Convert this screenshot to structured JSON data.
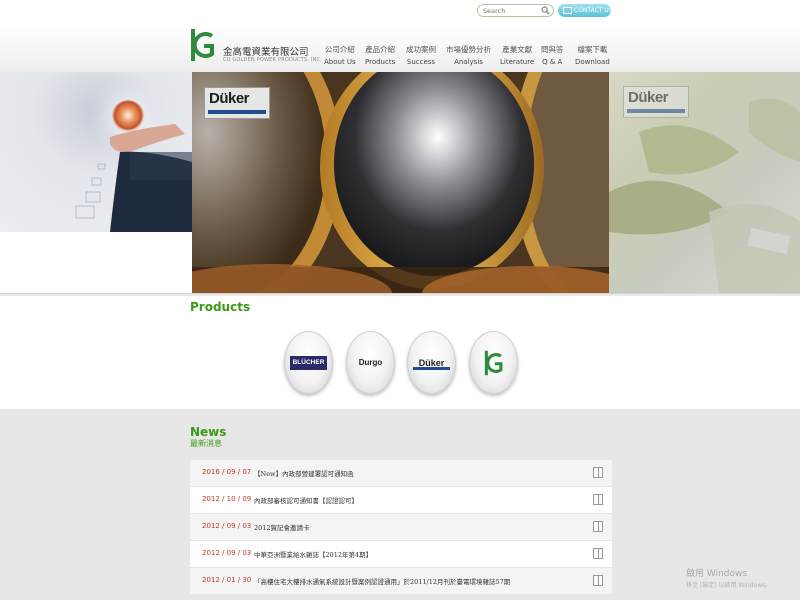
{
  "header": {
    "search_placeholder": "Search",
    "contact_label": "CONTACT US",
    "brand_cn": "金高電資業有限公司",
    "brand_en": "CU GOLDEN POWER PRODUCTS, INC.",
    "nav": [
      {
        "cn": "公司介紹",
        "en": "About Us"
      },
      {
        "cn": "產品介紹",
        "en": "Products"
      },
      {
        "cn": "成功案例",
        "en": "Success"
      },
      {
        "cn": "市場優勢分析",
        "en": "Analysis"
      },
      {
        "cn": "產業文獻",
        "en": "Literature"
      },
      {
        "cn": "問與答",
        "en": "Q & A"
      },
      {
        "cn": "檔案下載",
        "en": "Download"
      }
    ]
  },
  "hero": {
    "brand_badge": "Düker",
    "side_badge": "Düker"
  },
  "products": {
    "title": "Products",
    "items": [
      {
        "name": "BLÜCHER",
        "color": "#2a2a6a"
      },
      {
        "name": "Durgo",
        "color": "#222222"
      },
      {
        "name": "Düker",
        "color": "#1d4f8f"
      },
      {
        "name": "",
        "color": "#2e8b3d"
      }
    ]
  },
  "news": {
    "title_en": "News",
    "title_cn": "最新消息",
    "items": [
      {
        "date": "2016 / 09 / 07",
        "text": "【New】內政部營建署認可通知函"
      },
      {
        "date": "2012 / 10 / 09",
        "text": "內政部審核認可通知書【認證認可】"
      },
      {
        "date": "2012 / 09 / 03",
        "text": "2012賀記會邀請卡"
      },
      {
        "date": "2012 / 09 / 03",
        "text": "中華亞洲暨業給水雜誌【2012年第4期】"
      },
      {
        "date": "2012 / 01 / 30",
        "text": "「高樓住宅大樓排水通氣系統設計暨案例認證通用」於2011/12月刊於臺電環境雜誌57期"
      }
    ]
  },
  "watermark": {
    "line1": "啟用 Windows",
    "line2": "移至 [設定] 以啟用 Windows。"
  },
  "colors": {
    "accent_green": "#3a9a15",
    "date_red": "#c0392b",
    "contact_blue": "#5ec1d8"
  }
}
